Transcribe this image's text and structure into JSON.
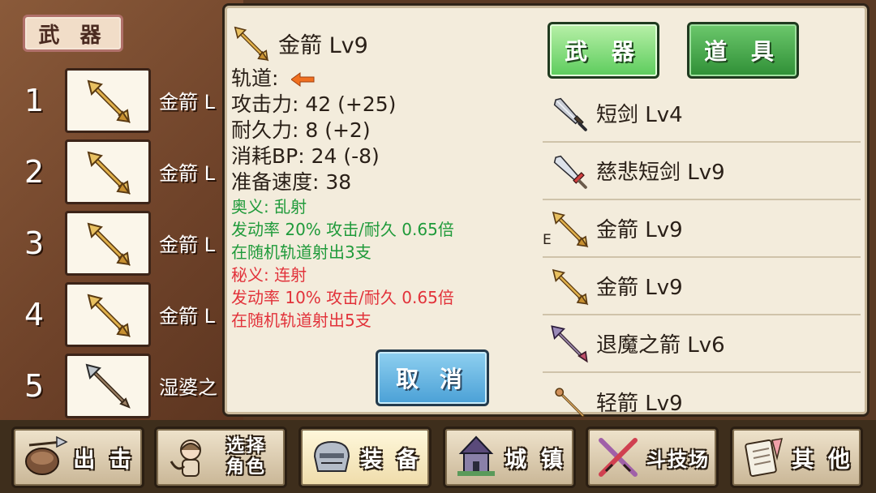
{
  "left_panel": {
    "tab_label": "武 器",
    "slots": [
      {
        "num": "1",
        "name": "金箭 L",
        "icon": "gold-arrow-icon"
      },
      {
        "num": "2",
        "name": "金箭 L",
        "icon": "gold-arrow-icon"
      },
      {
        "num": "3",
        "name": "金箭 L",
        "icon": "gold-arrow-icon"
      },
      {
        "num": "4",
        "name": "金箭 L",
        "icon": "gold-arrow-icon"
      },
      {
        "num": "5",
        "name": "湿婆之",
        "icon": "steel-arrow-icon"
      }
    ]
  },
  "detail": {
    "name": "金箭 Lv9",
    "track_label": "轨道:",
    "attack": "攻击力: 42 (+25)",
    "durability": "耐久力: 8 (+2)",
    "bp_cost": "消耗BP: 24 (-8)",
    "prep_speed": "准备速度: 38",
    "ougi_title": "奥义: 乱射",
    "ougi_line1": "发动率 20%  攻击/耐久 0.65倍",
    "ougi_line2": "在随机轨道射出3支",
    "higi_title": "秘义: 连射",
    "higi_line1": "发动率 10%    攻击/耐久 0.65倍",
    "higi_line2": "在随机轨道射出5支",
    "cancel_label": "取 消"
  },
  "tabs": {
    "weapon": "武 器",
    "item": "道 具"
  },
  "items": [
    {
      "name": "短剑 Lv4",
      "icon": "short-sword-icon",
      "equipped": ""
    },
    {
      "name": "慈悲短剑 Lv9",
      "icon": "mercy-dagger-icon",
      "equipped": ""
    },
    {
      "name": "金箭 Lv9",
      "icon": "gold-arrow-icon",
      "equipped": "E"
    },
    {
      "name": "金箭 Lv9",
      "icon": "gold-arrow-icon",
      "equipped": ""
    },
    {
      "name": "退魔之箭 Lv6",
      "icon": "exorcism-arrow-icon",
      "equipped": ""
    },
    {
      "name": "轻箭 Lv9",
      "icon": "light-arrow-icon",
      "equipped": ""
    }
  ],
  "nav": [
    {
      "label": "出 击",
      "icon": "sortie-icon"
    },
    {
      "label": "选择角色",
      "icon": "character-select-icon"
    },
    {
      "label": "装 备",
      "icon": "equipment-icon"
    },
    {
      "label": "城 镇",
      "icon": "town-icon"
    },
    {
      "label": "斗技场",
      "icon": "arena-icon"
    },
    {
      "label": "其 他",
      "icon": "other-icon"
    }
  ],
  "colors": {
    "skill_green": "#1f9a3a",
    "skill_red": "#e2323a",
    "track_arrow": "#f07020"
  }
}
